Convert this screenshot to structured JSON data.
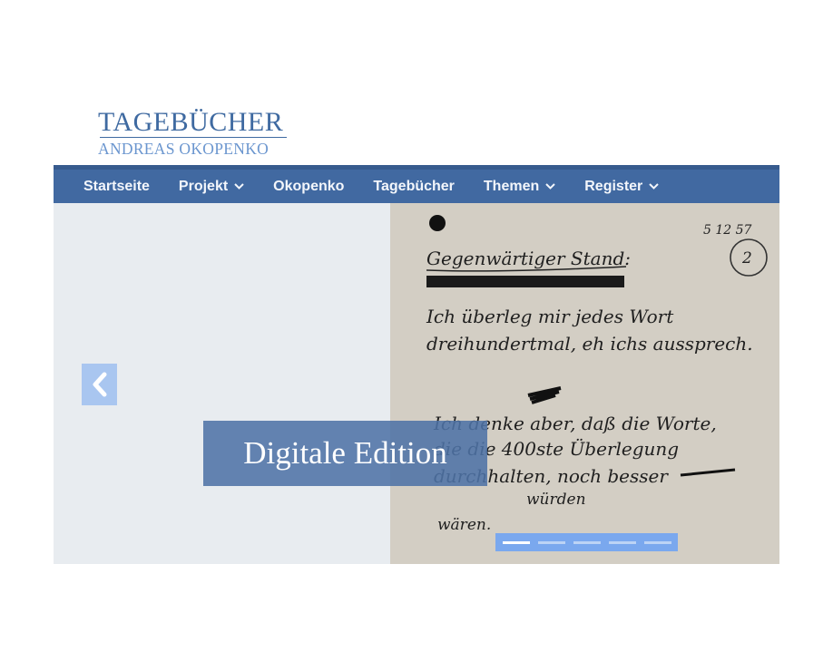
{
  "logo": {
    "title": "TAGEBÜCHER",
    "subtitle": "ANDREAS OKOPENKO"
  },
  "nav": {
    "items": [
      {
        "label": "Startseite",
        "dropdown": false
      },
      {
        "label": "Projekt",
        "dropdown": true
      },
      {
        "label": "Okopenko",
        "dropdown": false
      },
      {
        "label": "Tagebücher",
        "dropdown": false
      },
      {
        "label": "Themen",
        "dropdown": true
      },
      {
        "label": "Register",
        "dropdown": true
      }
    ]
  },
  "slider": {
    "caption": "Digitale Edition",
    "prev_icon": "chevron-left-icon",
    "slide_count": 5,
    "active_slide": 1,
    "manuscript": {
      "date": "5 12 57",
      "page": "2",
      "lines": [
        "Gegenwärtiger Stand:",
        "Ich überleg mir jedes Wort",
        "dreihundertmal, eh ichs aussprech.",
        "Ich denke aber, daß die Worte,",
        "die die 400ste Überlegung",
        "durchhalten, noch besser",
        "würden",
        "wären."
      ]
    }
  },
  "colors": {
    "brand": "#4169a1",
    "nav_border": "#375b8e",
    "logo_subtitle": "#6b96cf",
    "slider_bg": "#e8ecf0",
    "caption_bg": "#4e73a6",
    "paper": "#d3cec4"
  }
}
